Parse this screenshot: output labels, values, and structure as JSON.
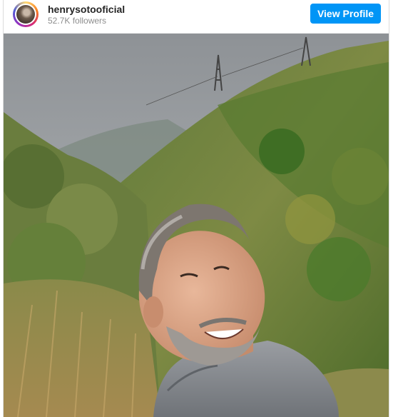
{
  "header": {
    "username": "henrysotooficial",
    "followers": "52.7K followers",
    "view_profile_label": "View Profile",
    "accent_color": "#0095f6"
  },
  "post": {
    "icon": "photo"
  }
}
